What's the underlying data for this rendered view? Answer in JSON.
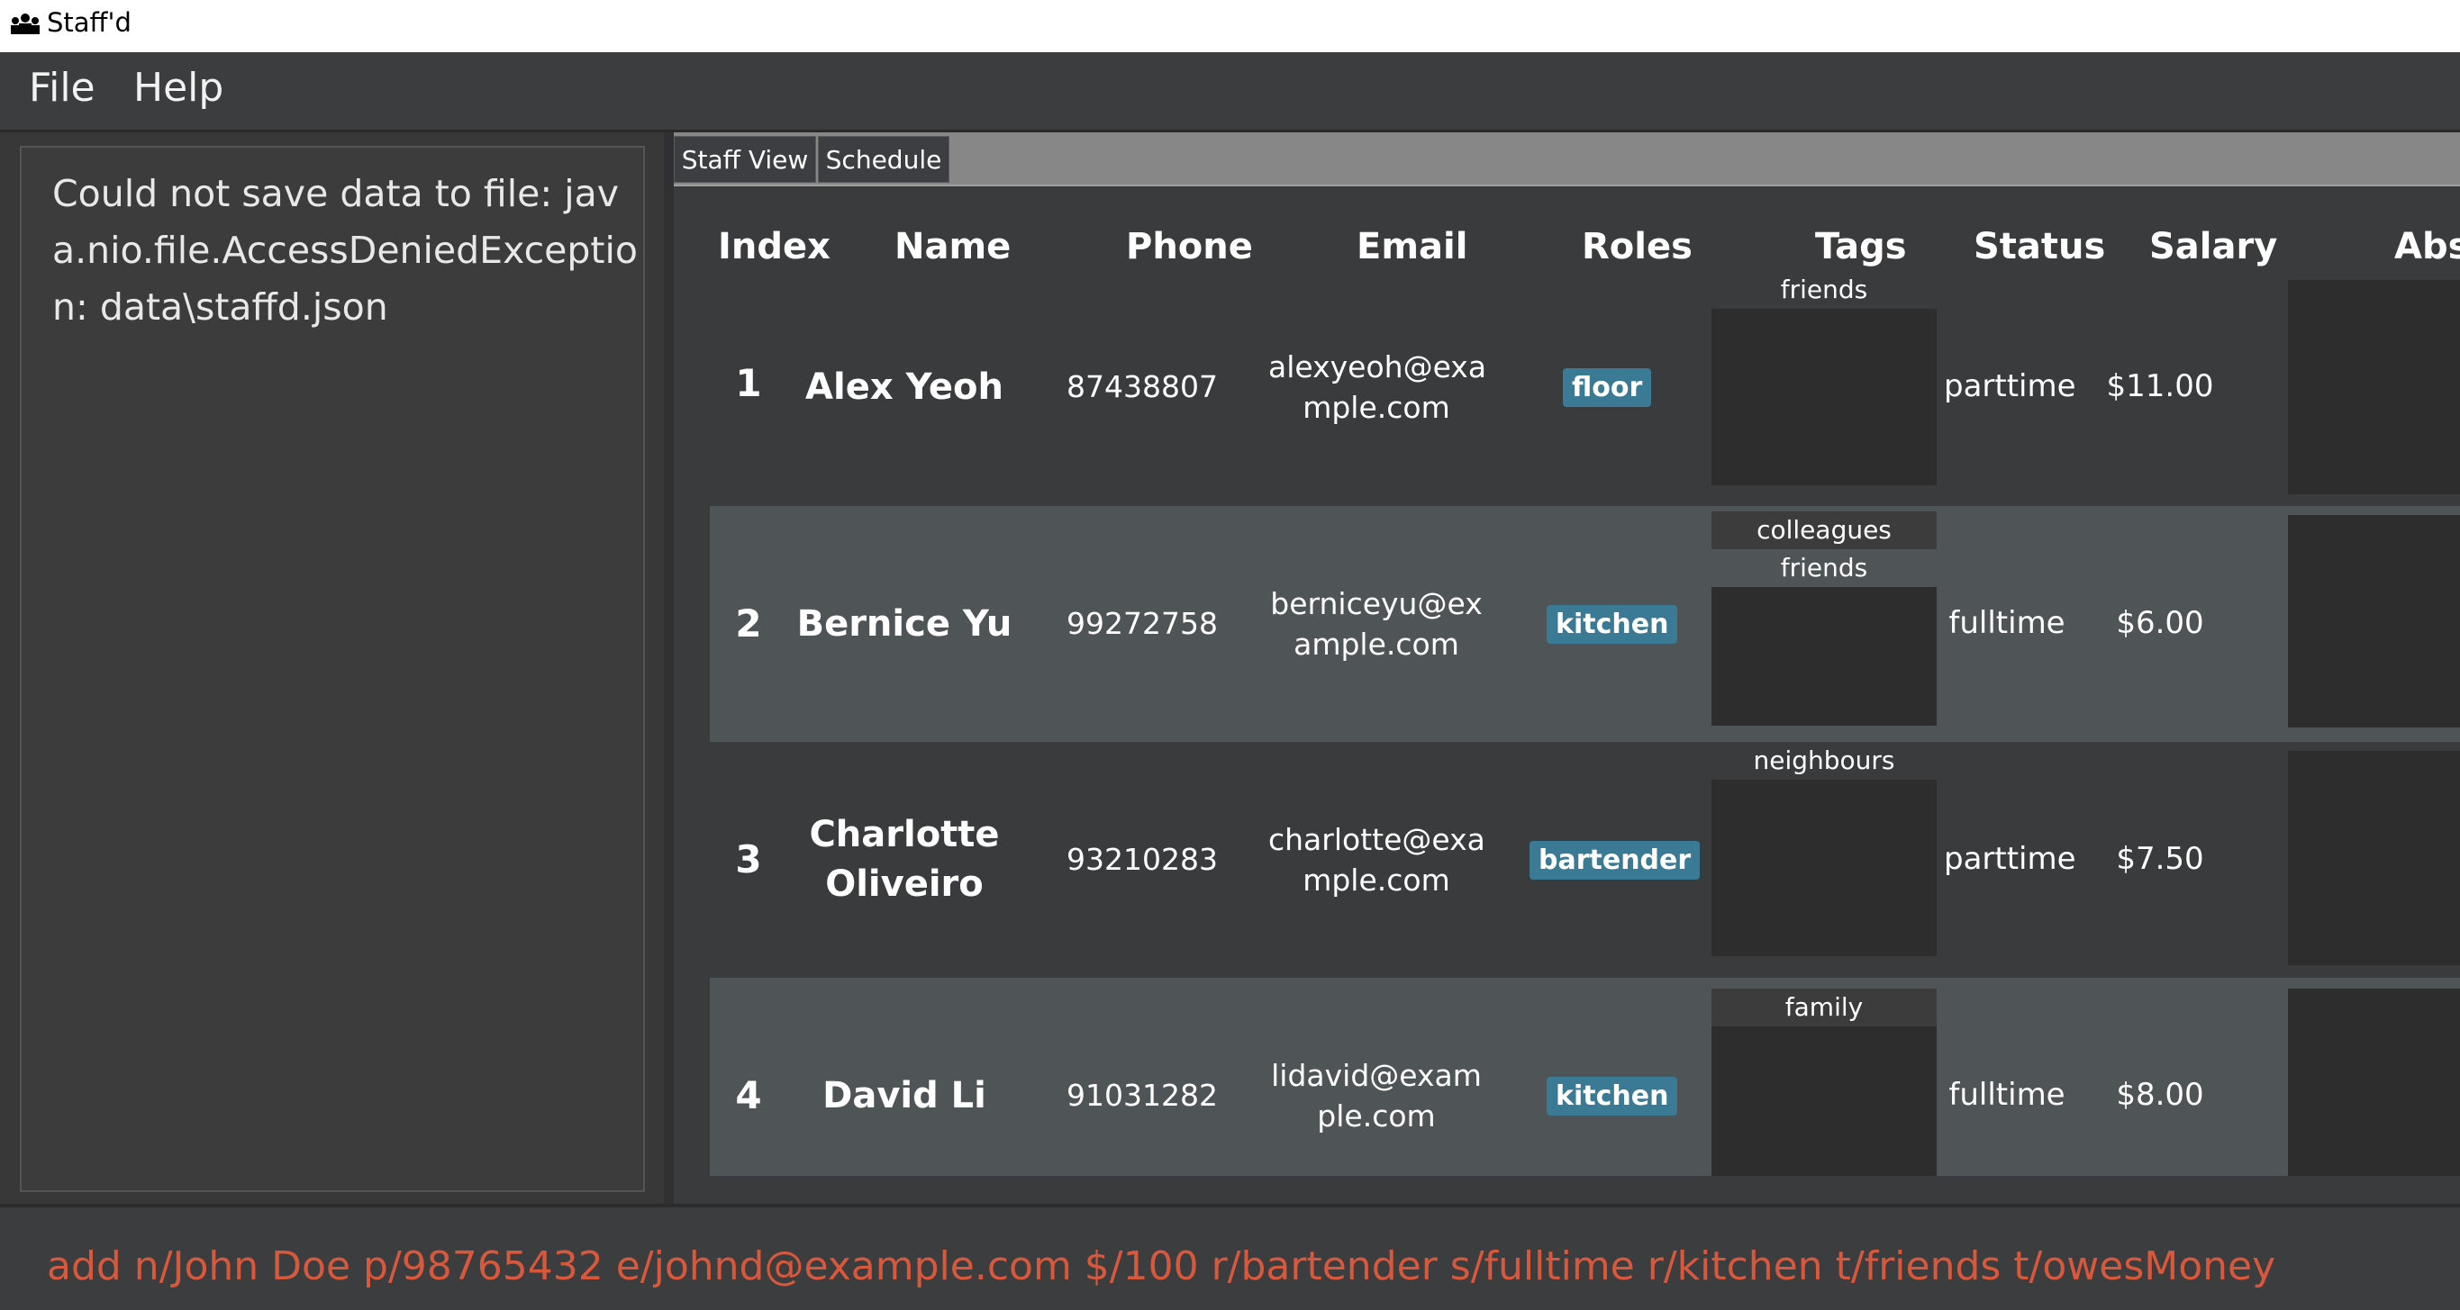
{
  "window": {
    "title": "Staff'd",
    "icon": "people-icon"
  },
  "menu": {
    "file": "File",
    "help": "Help"
  },
  "result_display": {
    "text": "Could not save data to file: java.nio.file.AccessDeniedException: data\\staffd.json"
  },
  "tabs": [
    {
      "label": "Staff View"
    },
    {
      "label": "Schedule"
    }
  ],
  "table": {
    "headers": {
      "index": "Index",
      "name": "Name",
      "phone": "Phone",
      "email": "Email",
      "roles": "Roles",
      "tags": "Tags",
      "status": "Status",
      "salary": "Salary",
      "absent": "Abs"
    },
    "rows": [
      {
        "index": "1",
        "name_line1": "Alex Yeoh",
        "name_line2": "",
        "phone": "87438807",
        "email_line1": "alexyeoh@exa",
        "email_line2": "mple.com",
        "role": "floor",
        "tags": [
          "friends"
        ],
        "status": "parttime",
        "salary": "$11.00"
      },
      {
        "index": "2",
        "name_line1": "Bernice Yu",
        "name_line2": "",
        "phone": "99272758",
        "email_line1": "berniceyu@ex",
        "email_line2": "ample.com",
        "role": "kitchen",
        "tags": [
          "colleagues",
          "friends"
        ],
        "status": "fulltime",
        "salary": "$6.00"
      },
      {
        "index": "3",
        "name_line1": "Charlotte",
        "name_line2": "Oliveiro",
        "phone": "93210283",
        "email_line1": "charlotte@exa",
        "email_line2": "mple.com",
        "role": "bartender",
        "tags": [
          "neighbours"
        ],
        "status": "parttime",
        "salary": "$7.50"
      },
      {
        "index": "4",
        "name_line1": "David Li",
        "name_line2": "",
        "phone": "91031282",
        "email_line1": "lidavid@exam",
        "email_line2": "ple.com",
        "role": "kitchen",
        "tags": [
          "family"
        ],
        "status": "fulltime",
        "salary": "$8.00"
      }
    ]
  },
  "command_box": {
    "value": "add n/John Doe p/98765432 e/johnd@example.com $/100 r/bartender s/fulltime r/kitchen t/friends t/owesMoney"
  },
  "colors": {
    "background": "#383838",
    "row_alt": "#4f5457",
    "role_badge": "#3b7a94",
    "command_text": "#d9583c"
  }
}
